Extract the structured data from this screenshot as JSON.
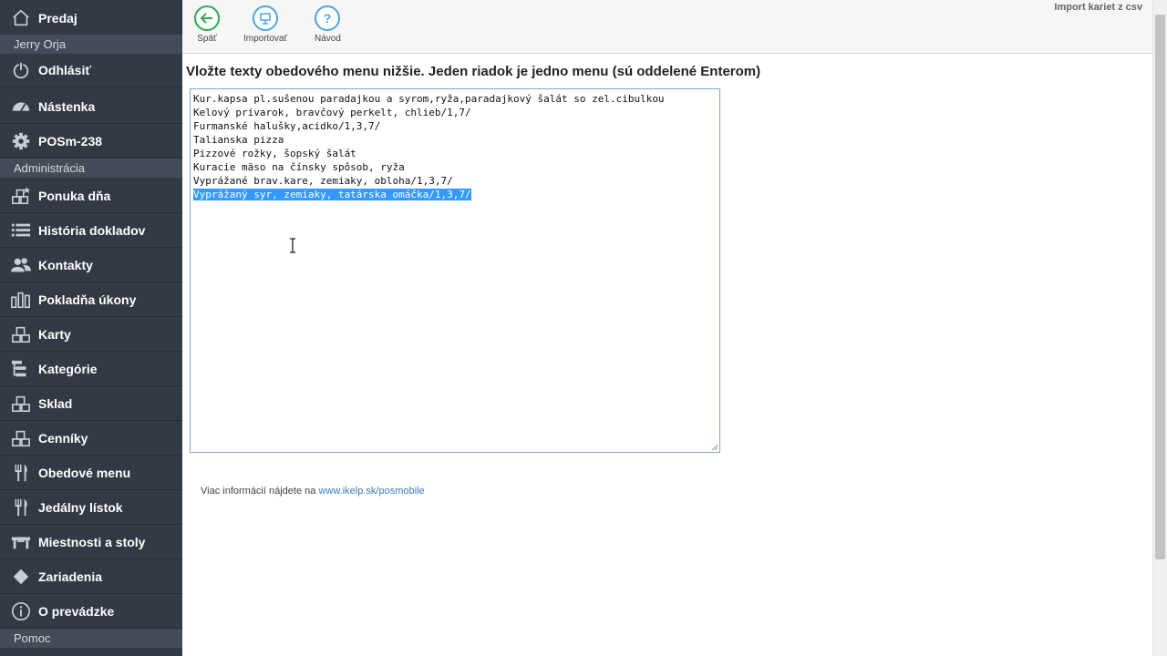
{
  "sidebar": {
    "top_item": {
      "label": "Predaj",
      "icon": "home-icon"
    },
    "user_header": "Jerry Orja",
    "user_items": [
      {
        "label": "Odhlásiť",
        "icon": "power-icon"
      },
      {
        "label": "Nástenka",
        "icon": "dashboard-icon"
      },
      {
        "label": "POSm-238",
        "icon": "gear-icon"
      }
    ],
    "admin_header": "Administrácia",
    "admin_items": [
      {
        "label": "Ponuka dňa",
        "icon": "boxes-star-icon"
      },
      {
        "label": "História dokladov",
        "icon": "list-icon"
      },
      {
        "label": "Kontakty",
        "icon": "users-icon"
      },
      {
        "label": "Pokladňa úkony",
        "icon": "bars-icon"
      },
      {
        "label": "Karty",
        "icon": "boxes-icon"
      },
      {
        "label": "Kategórie",
        "icon": "tree-icon"
      },
      {
        "label": "Sklad",
        "icon": "boxes-icon"
      },
      {
        "label": "Cenníky",
        "icon": "boxes-icon"
      },
      {
        "label": "Obedové menu",
        "icon": "cutlery-icon"
      },
      {
        "label": "Jedálny lístok",
        "icon": "cutlery-icon"
      },
      {
        "label": "Miestnosti a stoly",
        "icon": "table-icon"
      },
      {
        "label": "Zariadenia",
        "icon": "diamond-icon"
      },
      {
        "label": "O prevádzke",
        "icon": "info-icon"
      }
    ],
    "help_header": "Pomoc"
  },
  "toolbar": {
    "back_label": "Späť",
    "import_label": "Importovať",
    "guide_label": "Návod",
    "import_csv_link": "Import kariet z csv"
  },
  "main": {
    "heading": "Vložte texty obedového menu nižšie. Jeden riadok je jedno menu (sú oddelené Enterom)",
    "menu_lines": [
      "Kur.kapsa pl.sušenou paradajkou a syrom,ryža,paradajkový šalát so zel.cibulkou",
      "Kelový prívarok, bravčový perkelt, chlieb/1,7/",
      "Furmanské halušky,acidko/1,3,7/",
      "Talianska pizza",
      "Pizzové rožky, šopský šalát",
      "Kuracie mäso na čínsky spôsob, ryža",
      "Vyprážané brav.kare, zemiaky, obloha/1,3,7/",
      "Vyprážaný syr, zemiaky, tatárska omáčka/1,3,7/"
    ],
    "selected_line_index": 7,
    "footer_prefix": "Viac informácií nájdete na ",
    "footer_link": "www.ikelp.sk/posmobile"
  },
  "colors": {
    "sidebar_bg": "#323a45",
    "sidebar_header_bg": "#434c58",
    "accent": "#4ea6dd",
    "back_icon": "#2fa84f",
    "selection": "#3399ff",
    "link": "#3a7bbf"
  }
}
